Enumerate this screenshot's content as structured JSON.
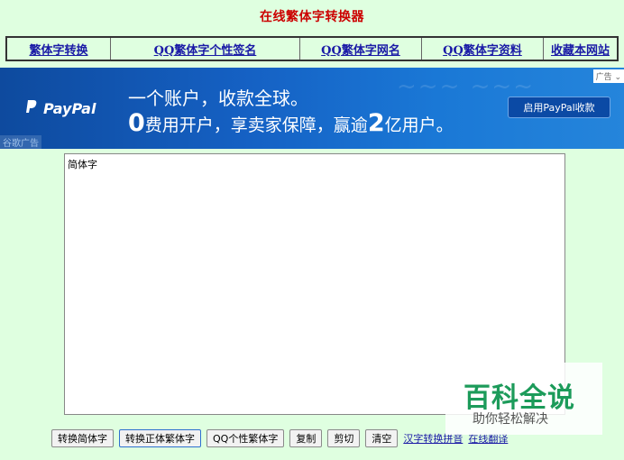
{
  "site": {
    "title": "在线繁体字转换器"
  },
  "nav": {
    "items": [
      {
        "label": "繁体字转换"
      },
      {
        "label": "QQ繁体字个性签名"
      },
      {
        "label": "QQ繁体字网名"
      },
      {
        "label": "QQ繁体字资料"
      },
      {
        "label": "收藏本网站"
      }
    ]
  },
  "ad": {
    "brand": "PayPal",
    "headline": "一个账户，收款全球。",
    "sub_lead": "0",
    "sub_mid": "费用开户，享卖家保障，赢逾",
    "sub_num": "2",
    "sub_tail": "亿用户。",
    "cta": "启用PayPal收款",
    "flag": "广告",
    "source": "谷歌广告"
  },
  "editor": {
    "value": "简体字"
  },
  "buttons": {
    "to_simplified": "转换简体字",
    "to_traditional": "转换正体繁体字",
    "qq_traditional": "QQ个性繁体字",
    "copy": "复制",
    "cut": "剪切",
    "clear": "清空"
  },
  "links": {
    "pinyin": "汉字转换拼音",
    "translate": "在线翻译"
  },
  "watermark": {
    "name": "百科全说",
    "tagline": "助你轻松解决"
  }
}
